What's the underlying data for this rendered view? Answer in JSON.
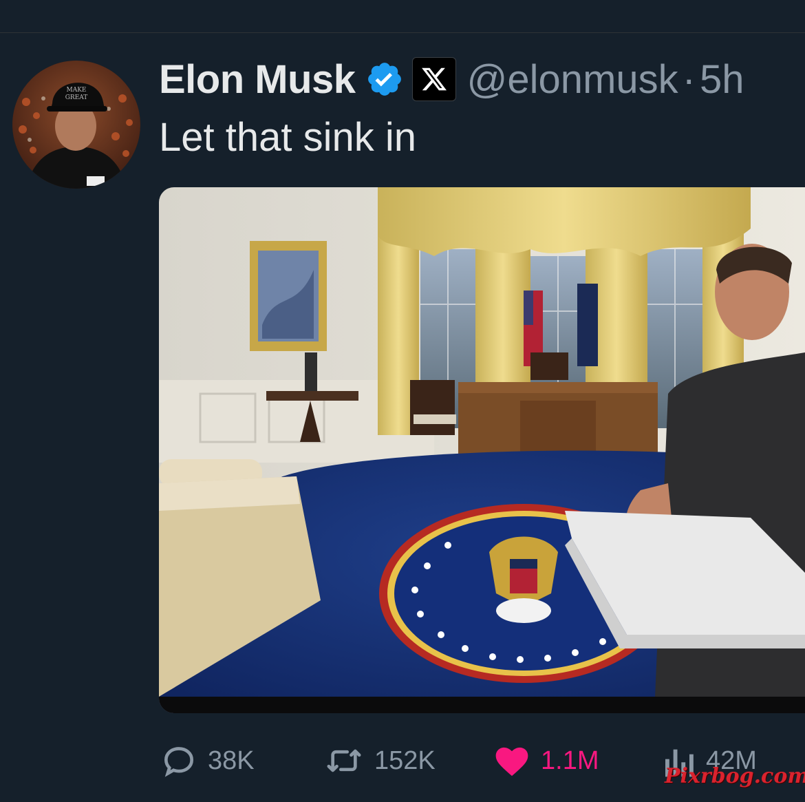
{
  "tweet": {
    "author_name": "Elon Musk",
    "handle": "@elonmusk",
    "separator": "·",
    "time": "5h",
    "text": "Let that sink in"
  },
  "icons": {
    "verified": "verified-badge-icon",
    "affiliation": "x-logo-icon",
    "reply": "reply-icon",
    "retweet": "retweet-icon",
    "like": "heart-icon",
    "views": "views-icon"
  },
  "stats": {
    "replies": "38K",
    "retweets": "152K",
    "likes": "1.1M",
    "views": "42M"
  },
  "watermark": "Pixrbog.com",
  "colors": {
    "background": "#15202b",
    "verified_blue": "#1d9bf0",
    "like_pink": "#f91880",
    "muted_text": "#8b98a5"
  }
}
